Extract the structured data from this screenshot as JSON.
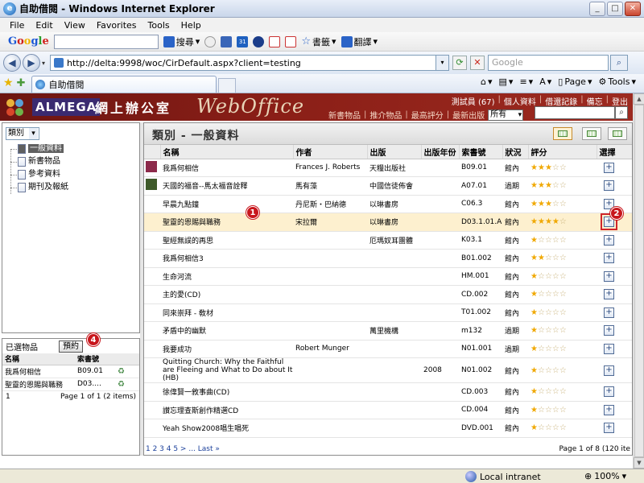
{
  "window": {
    "title": "自助借閱 - Windows Internet Explorer",
    "controls": [
      "_",
      "□",
      "✕"
    ]
  },
  "menu": [
    "File",
    "Edit",
    "View",
    "Favorites",
    "Tools",
    "Help"
  ],
  "google_toolbar": {
    "logo": [
      "G",
      "o",
      "o",
      "g",
      "l",
      "e"
    ],
    "search_label": "搜尋",
    "bookmarks_label": "書籤",
    "translate_label": "翻譯",
    "calendar_badge": "31"
  },
  "address": {
    "url": "http://delta:9998/woc/CirDefault.aspx?client=testing",
    "search_placeholder": "Google"
  },
  "tabs": [
    {
      "label": "自助借閱"
    }
  ],
  "commands": {
    "page": "Page",
    "tools": "Tools"
  },
  "site": {
    "brand": "ALMEGA",
    "office_cn": "網上辦公室",
    "webtitle": "WebOffice",
    "user_links": [
      "測試員 (67)",
      "個人資料",
      "借還記錄",
      "備忘",
      "登出"
    ],
    "nav_links": [
      "新書物品",
      "推介物品",
      "最高評分",
      "最新出版"
    ],
    "type_select_value": "所有"
  },
  "left": {
    "category_select": "類別",
    "tree": [
      "一般資料",
      "新書物品",
      "參考資料",
      "期刊及報紙"
    ],
    "selected_tree_index": 0
  },
  "selected_items": {
    "label": "已選物品",
    "reserve_button": "預約",
    "columns": [
      "名稱",
      "索書號",
      ""
    ],
    "rows": [
      {
        "name": "我爲何相信",
        "call": "B09.01"
      },
      {
        "name": "聖靈的恩賜與職務",
        "call": "D03...."
      }
    ],
    "pager": {
      "page": "1",
      "page_label": "Page 1 of 1",
      "items": "(2 items)"
    }
  },
  "main": {
    "title": "類別 - 一般資料",
    "columns": [
      "",
      "名稱",
      "作者",
      "出版",
      "出版年份",
      "索書號",
      "狀況",
      "評分",
      "選擇"
    ],
    "rows": [
      {
        "title": "我爲何相信",
        "author": "Frances J. Roberts",
        "publisher": "天糧出版社",
        "year": "",
        "call": "B09.01",
        "status": "館內",
        "rating": 3,
        "thumb": "#8c2a4a"
      },
      {
        "title": "天國的福音--馬太福音詮釋",
        "author": "馬有藻",
        "publisher": "中國信徒佈會",
        "year": "",
        "call": "A07.01",
        "status": "過期",
        "rating": 3,
        "thumb": "#3f5a2a"
      },
      {
        "title": "早晨九點鐘",
        "author": "丹尼斯・巴納德",
        "publisher": "以琳書房",
        "year": "",
        "call": "C06.3",
        "status": "館內",
        "rating": 3,
        "thumb": ""
      },
      {
        "title": "聖靈的恩賜與職務",
        "author": "宋拉爾",
        "publisher": "以琳書房",
        "year": "",
        "call": "D03.1.01.A",
        "status": "館內",
        "rating": 4,
        "thumb": "",
        "selected": true
      },
      {
        "title": "聖經無誤的再思",
        "author": "",
        "publisher": "厄瑪奴耳團體",
        "year": "",
        "call": "K03.1",
        "status": "館內",
        "rating": 1,
        "thumb": ""
      },
      {
        "title": "我爲何相信3",
        "author": "",
        "publisher": "",
        "year": "",
        "call": "B01.002",
        "status": "館內",
        "rating": 2,
        "thumb": ""
      },
      {
        "title": "生命河流",
        "author": "",
        "publisher": "",
        "year": "",
        "call": "HM.001",
        "status": "館內",
        "rating": 1,
        "thumb": ""
      },
      {
        "title": "主的愛(CD)",
        "author": "",
        "publisher": "",
        "year": "",
        "call": "CD.002",
        "status": "館內",
        "rating": 1,
        "thumb": ""
      },
      {
        "title": "同來崇拜 - 敎材",
        "author": "",
        "publisher": "",
        "year": "",
        "call": "T01.002",
        "status": "館內",
        "rating": 1,
        "thumb": ""
      },
      {
        "title": "矛盾中的幽默",
        "author": "",
        "publisher": "萬里機構",
        "year": "",
        "call": "m132",
        "status": "過期",
        "rating": 1,
        "thumb": ""
      },
      {
        "title": "我要成功",
        "author": "Robert Munger",
        "publisher": "",
        "year": "",
        "call": "N01.001",
        "status": "過期",
        "rating": 1,
        "thumb": ""
      },
      {
        "title": "Quitting Church: Why the Faithful are Fleeing and What to Do about It (HB)",
        "author": "",
        "publisher": "",
        "year": "2008",
        "call": "N01.002",
        "status": "館內",
        "rating": 1,
        "thumb": ""
      },
      {
        "title": "徐偉賢一敘事曲(CD)",
        "author": "",
        "publisher": "",
        "year": "",
        "call": "CD.003",
        "status": "館內",
        "rating": 1,
        "thumb": ""
      },
      {
        "title": "讃忘理查斯創作精選CD",
        "author": "",
        "publisher": "",
        "year": "",
        "call": "CD.004",
        "status": "館內",
        "rating": 1,
        "thumb": ""
      },
      {
        "title": "Yeah Show2008唱生唱死",
        "author": "",
        "publisher": "",
        "year": "",
        "call": "DVD.001",
        "status": "館內",
        "rating": 1,
        "thumb": ""
      }
    ],
    "pager": {
      "links": "1 2 3 4 5 > ... Last »",
      "page_info": "Page 1 of 8 (120 ite"
    }
  },
  "callouts": [
    "1",
    "2",
    "4"
  ],
  "status": {
    "zone": "Local intranet",
    "zoom": "100%"
  }
}
